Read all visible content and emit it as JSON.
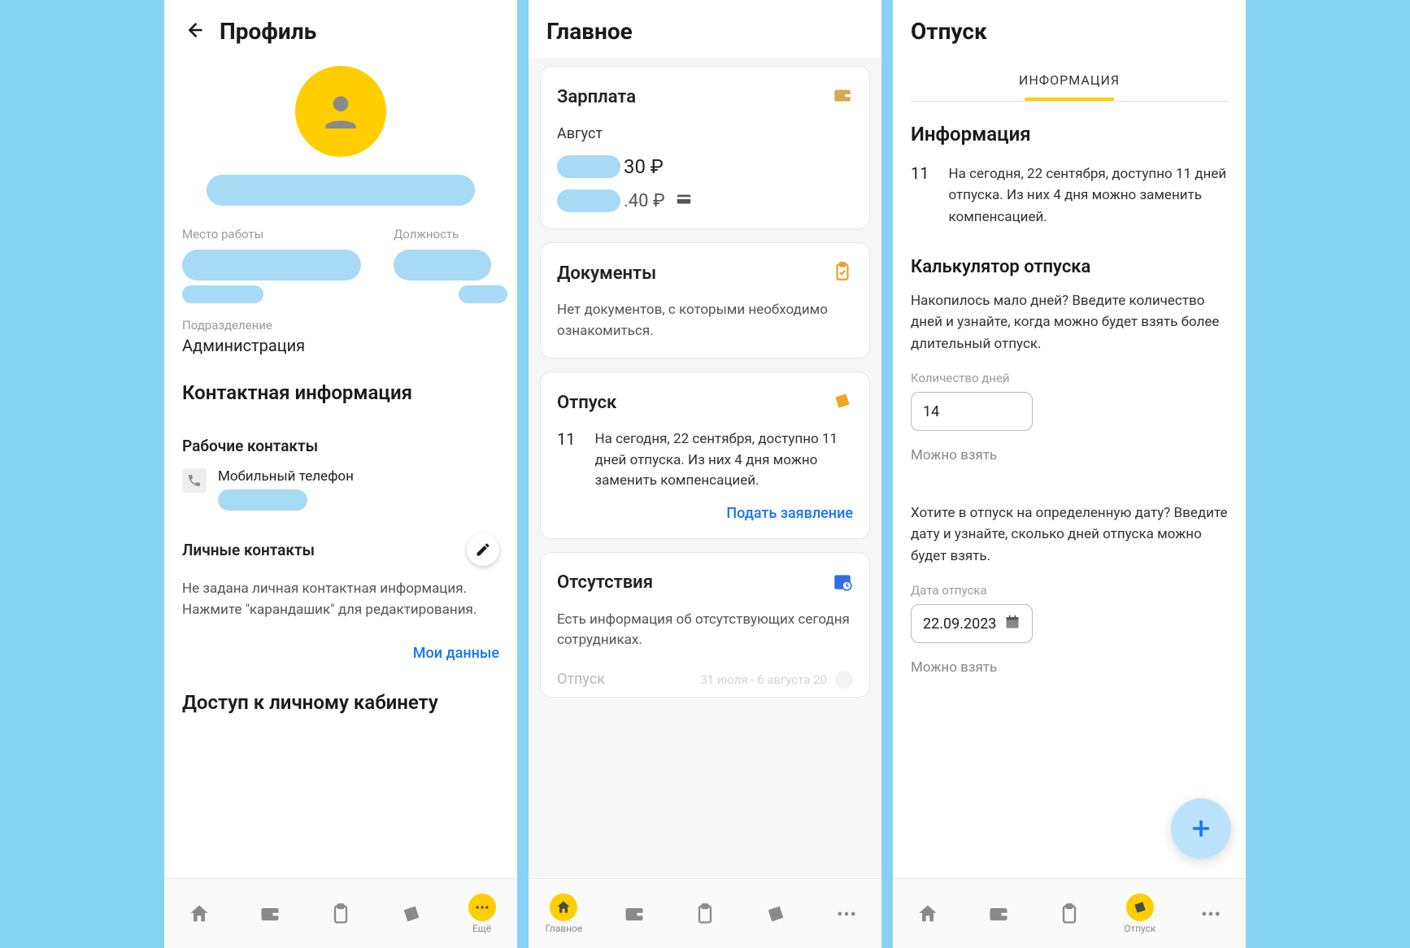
{
  "screen1": {
    "title": "Профиль",
    "workplace_label": "Место работы",
    "position_label": "Должность",
    "department_label": "Подразделение",
    "department_value": "Администрация",
    "contact_info_title": "Контактная информация",
    "work_contacts_title": "Рабочие контакты",
    "mobile_phone_label": "Мобильный телефон",
    "personal_contacts_title": "Личные контакты",
    "personal_contacts_hint": "Не задана личная контактная информация. Нажмите \"карандашик\" для редактирования.",
    "my_data_link": "Мои данные",
    "access_title": "Доступ к личному кабинету",
    "nav_more": "Ещё"
  },
  "screen2": {
    "title": "Главное",
    "salary": {
      "title": "Зарплата",
      "month": "Август",
      "amount1_suffix": "30 ₽",
      "amount2_suffix": ".40 ₽"
    },
    "documents": {
      "title": "Документы",
      "text": "Нет документов, с которыми необходимо ознакомиться."
    },
    "vacation": {
      "title": "Отпуск",
      "days": "11",
      "text": "На сегодня, 22 сентября, доступно 11 дней отпуска. Из них 4 дня можно заменить компенсацией.",
      "apply_link": "Подать заявление"
    },
    "absences": {
      "title": "Отсутствия",
      "text": "Есть информация об отсутствующих сегодня сотрудниках.",
      "row_label": "Отпуск",
      "row_dates": "31 июля - 6 августа 20"
    },
    "nav_main": "Главное"
  },
  "screen3": {
    "title": "Отпуск",
    "tab": "ИНФОРМАЦИЯ",
    "info_title": "Информация",
    "info_days": "11",
    "info_text": "На сегодня, 22 сентября, доступно 11 дней отпуска. Из них 4 дня можно заменить компенсацией.",
    "calc_title": "Калькулятор отпуска",
    "calc_hint1": "Накопилось мало дней? Введите количество дней и узнайте, когда можно будет взять более длительный отпуск.",
    "days_label": "Количество дней",
    "days_input": "14",
    "can_take": "Можно взять",
    "calc_hint2": "Хотите в отпуск на определенную дату? Введите дату и узнайте, сколько дней отпуска можно будет взять.",
    "date_label": "Дата отпуска",
    "date_input": "22.09.2023",
    "nav_vacation": "Отпуск"
  }
}
